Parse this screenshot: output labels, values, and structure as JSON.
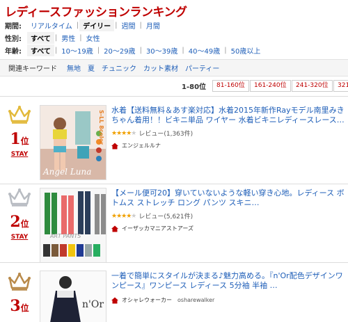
{
  "page_title": "レディースファッションランキング",
  "filters": [
    {
      "label": "期間:",
      "options": [
        {
          "text": "リアルタイム",
          "active": false
        },
        {
          "text": "デイリー",
          "active": true
        },
        {
          "text": "週間",
          "active": false
        },
        {
          "text": "月間",
          "active": false
        }
      ]
    },
    {
      "label": "性別:",
      "options": [
        {
          "text": "すべて",
          "active": true
        },
        {
          "text": "男性",
          "active": false
        },
        {
          "text": "女性",
          "active": false
        }
      ]
    },
    {
      "label": "年齢:",
      "options": [
        {
          "text": "すべて",
          "active": true
        },
        {
          "text": "10〜19歳",
          "active": false
        },
        {
          "text": "20〜29歳",
          "active": false
        },
        {
          "text": "30〜39歳",
          "active": false
        },
        {
          "text": "40〜49歳",
          "active": false
        },
        {
          "text": "50歳以上",
          "active": false
        }
      ]
    }
  ],
  "keywords": {
    "label": "関連キーワード",
    "items": [
      "無地",
      "夏",
      "チュニック",
      "カット素材",
      "パーティー"
    ]
  },
  "pager": {
    "current": "1-80位",
    "pages": [
      "81-160位",
      "161-240位",
      "241-320位",
      "321-"
    ]
  },
  "items": [
    {
      "rank": "1",
      "rank_unit": "位",
      "status": "STAY",
      "title": "水着【送料無料＆あす楽対応】水着2015年新作Rayモデル南里みきちゃん着用！！ビキニ単品 ワイヤー 水着ビキニレディースレース…",
      "rating": 4,
      "review_text": "レビュー(1,363件)",
      "shop": "エンジェルルナ",
      "shop_id": "",
      "image_caption": "Angel Luna",
      "image_side_text": "S-LL 8color",
      "crown_color": "#e2b93b"
    },
    {
      "rank": "2",
      "rank_unit": "位",
      "status": "STAY",
      "title": "【メール便可20】穿いていないような軽い穿き心地。レディース ボトムス ストレッチ ロング パンツ スキニ…",
      "rating": 4,
      "review_text": "レビュー(5,621件)",
      "shop": "イーザッカマニアストアーズ",
      "shop_id": "",
      "image_caption": "ART PANTS",
      "image_side_text": "",
      "crown_color": "#b8bcc2"
    },
    {
      "rank": "3",
      "rank_unit": "位",
      "status": "",
      "title": "一着で簡単にスタイルが決まる♪魅力高める。『n'Or配色デザインワンピース』ワンピース レディース 5分袖 半袖 …",
      "rating": 0,
      "review_text": "",
      "shop": "オシャレウォーカー",
      "shop_id": "osharewalker",
      "image_caption": "n'Or",
      "image_side_text": "",
      "crown_color": "#b98a4a"
    }
  ]
}
